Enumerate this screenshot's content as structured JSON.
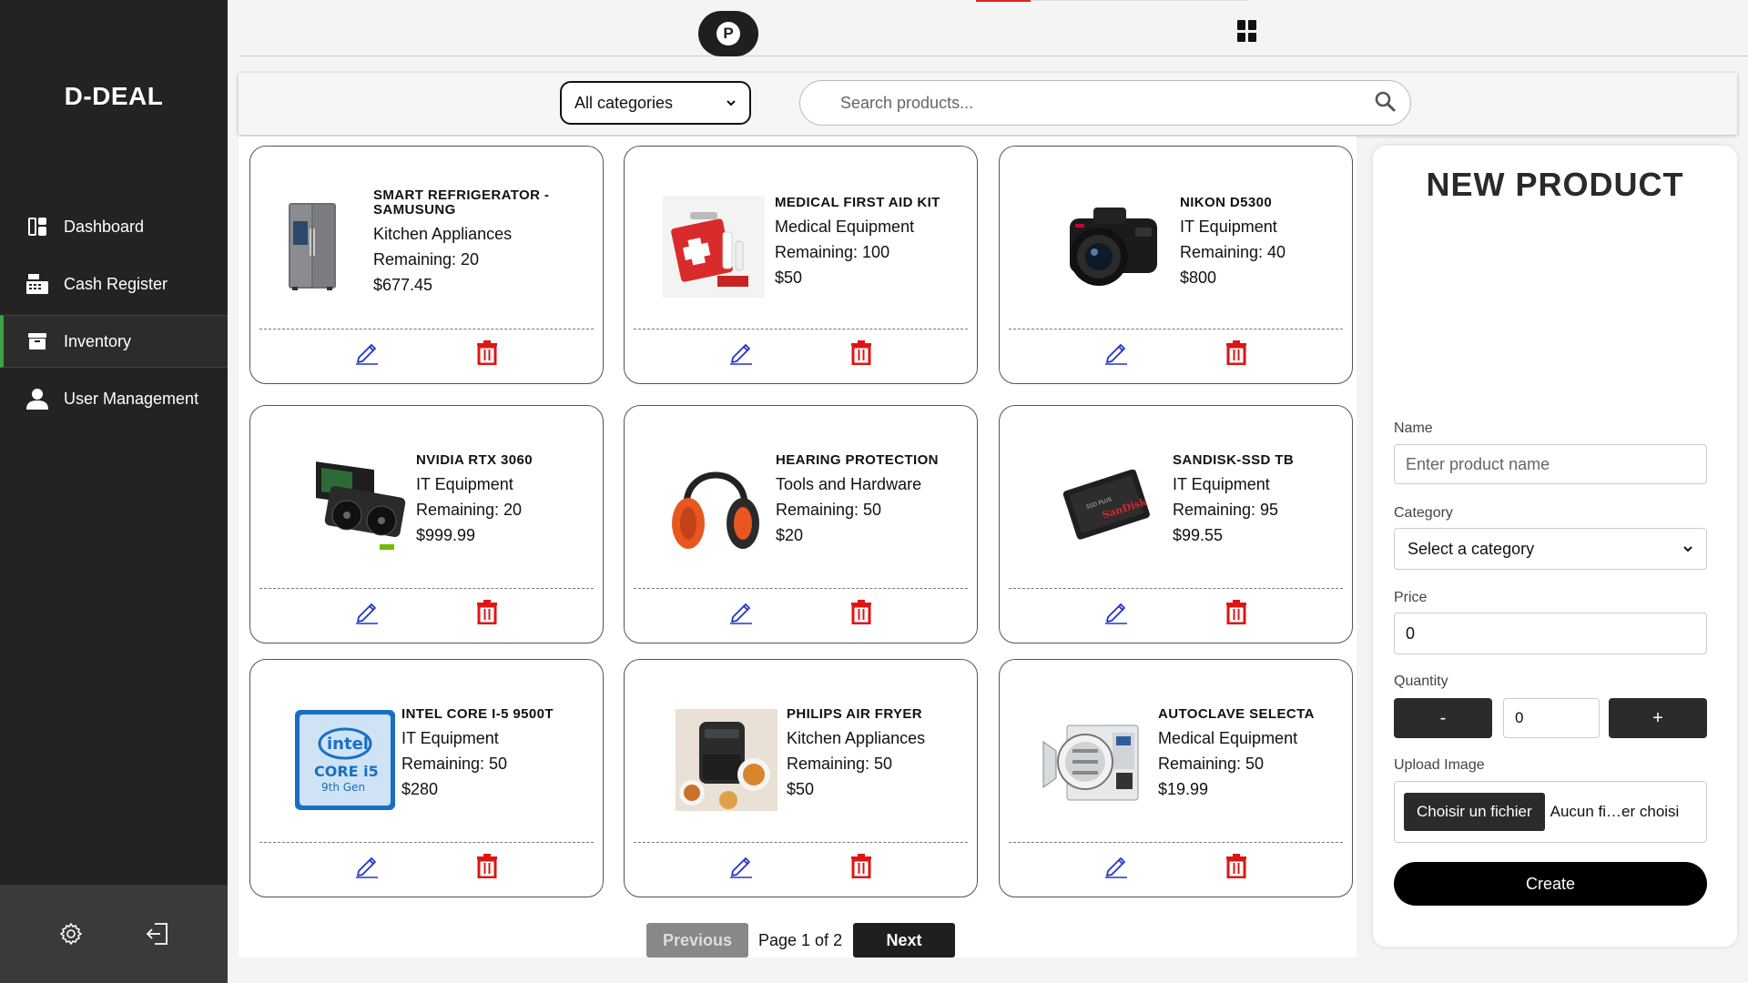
{
  "app": {
    "logo": "D-DEAL"
  },
  "sidebar": {
    "items": [
      {
        "label": "Dashboard",
        "icon": "dashboard-icon"
      },
      {
        "label": "Cash Register",
        "icon": "cash-register-icon"
      },
      {
        "label": "Inventory",
        "icon": "inventory-icon",
        "active": true
      },
      {
        "label": "User Management",
        "icon": "user-icon"
      }
    ],
    "footer": {
      "settings_icon": "gear-icon",
      "logout_icon": "logout-icon"
    }
  },
  "topbar": {
    "profile_letter": "P",
    "grid_icon": "grid-view-icon"
  },
  "filters": {
    "category_value": "All categories",
    "search_placeholder": "Search products..."
  },
  "products": [
    {
      "name": "SMART REFRIGERATOR - SAMUSUNG",
      "category": "Kitchen Appliances",
      "remaining": "Remaining: 20",
      "price": "$677.45"
    },
    {
      "name": "MEDICAL FIRST AID KIT",
      "category": "Medical Equipment",
      "remaining": "Remaining: 100",
      "price": "$50"
    },
    {
      "name": "NIKON D5300",
      "category": "IT Equipment",
      "remaining": "Remaining: 40",
      "price": "$800"
    },
    {
      "name": "NVIDIA RTX 3060",
      "category": "IT Equipment",
      "remaining": "Remaining: 20",
      "price": "$999.99"
    },
    {
      "name": "HEARING PROTECTION",
      "category": "Tools and Hardware",
      "remaining": "Remaining: 50",
      "price": "$20"
    },
    {
      "name": "SANDISK-SSD TB",
      "category": "IT Equipment",
      "remaining": "Remaining: 95",
      "price": "$99.55"
    },
    {
      "name": "INTEL CORE I-5 9500T",
      "category": "IT Equipment",
      "remaining": "Remaining: 50",
      "price": "$280"
    },
    {
      "name": "PHILIPS AIR FRYER",
      "category": "Kitchen Appliances",
      "remaining": "Remaining: 50",
      "price": "$50"
    },
    {
      "name": "AUTOCLAVE SELECTA",
      "category": "Medical Equipment",
      "remaining": "Remaining: 50",
      "price": "$19.99"
    }
  ],
  "pagination": {
    "previous": "Previous",
    "page_info": "Page 1 of 2",
    "next": "Next"
  },
  "new_product": {
    "title": "NEW PRODUCT",
    "name_label": "Name",
    "name_placeholder": "Enter product name",
    "category_label": "Category",
    "category_value": "Select a category",
    "price_label": "Price",
    "price_value": "0",
    "quantity_label": "Quantity",
    "minus": "-",
    "quantity_value": "0",
    "plus": "+",
    "upload_label": "Upload Image",
    "choose_file": "Choisir un fichier",
    "no_file": "Aucun fi…er choisi",
    "create": "Create"
  },
  "colors": {
    "sidebar_bg": "#232323",
    "active_accent": "#3aa442",
    "delete_red": "#e01414",
    "edit_blue": "#2233cc"
  }
}
